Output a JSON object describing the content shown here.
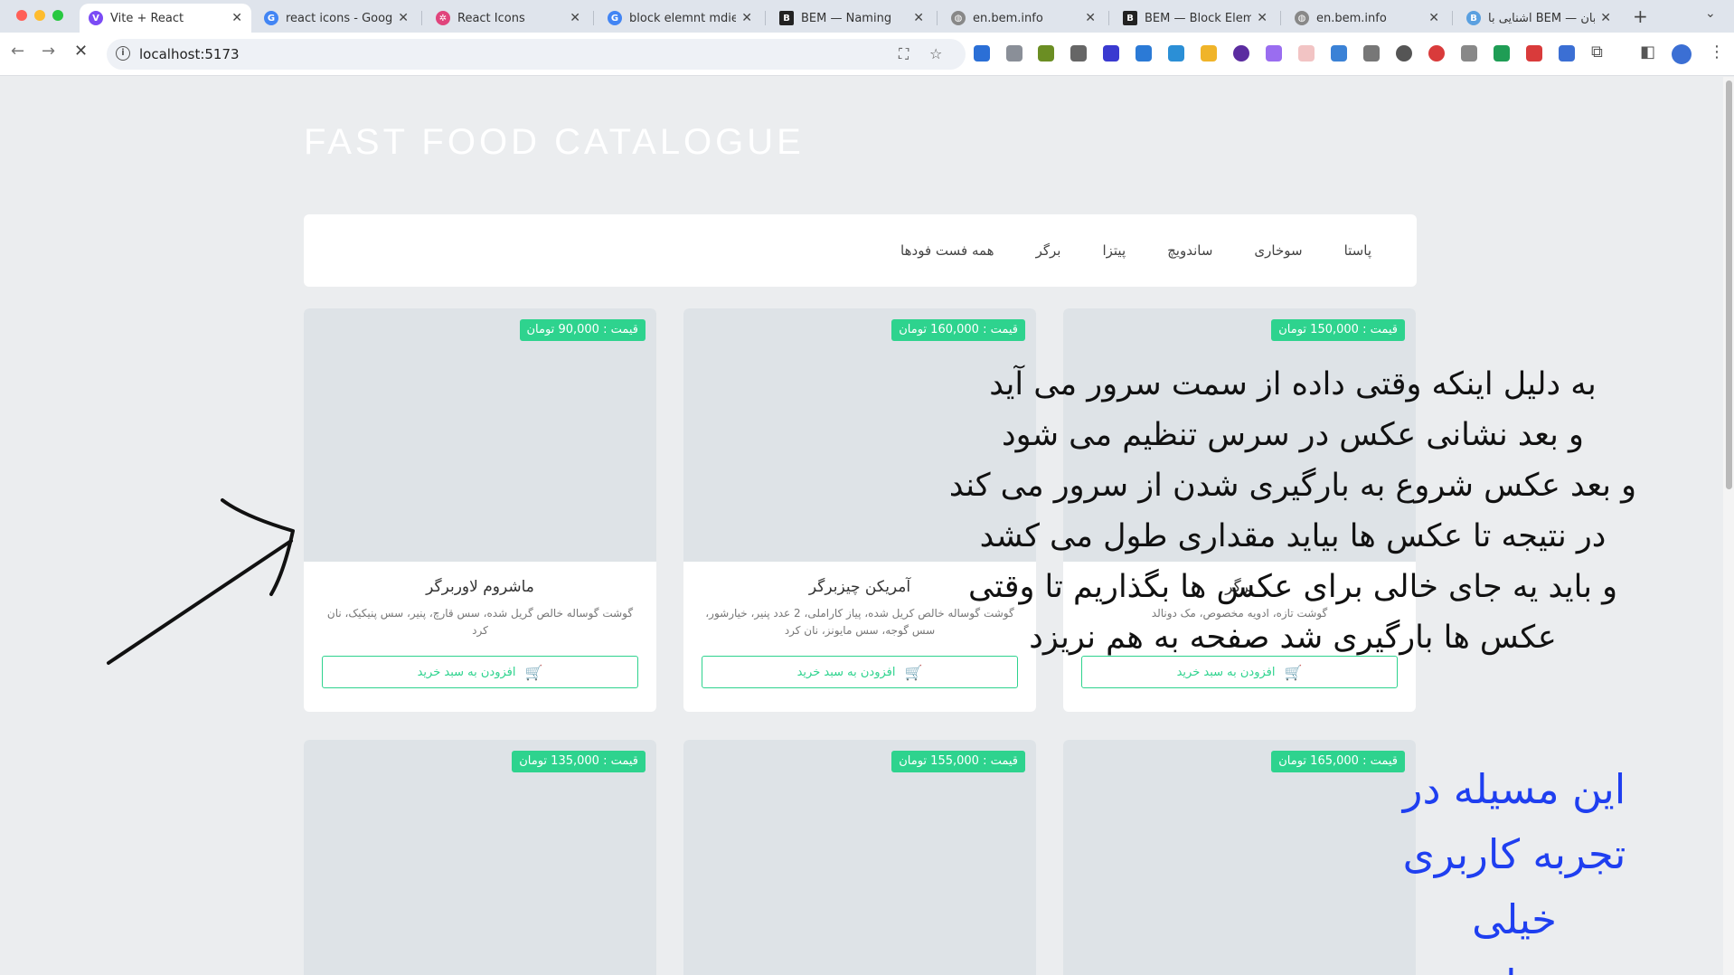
{
  "browser": {
    "tabs": [
      {
        "label": "Vite + React",
        "active": true,
        "favicon": "vite-icon",
        "favicon_color": "#7b4bf5"
      },
      {
        "label": "react icons - Google",
        "active": false,
        "favicon": "google-icon",
        "favicon_color": "#4285f4"
      },
      {
        "label": "React Icons",
        "active": false,
        "favicon": "react-icon",
        "favicon_color": "#e0447c"
      },
      {
        "label": "block elemnt mdier",
        "active": false,
        "favicon": "google-icon",
        "favicon_color": "#4285f4"
      },
      {
        "label": "BEM — Naming",
        "active": false,
        "favicon": "bem-icon",
        "favicon_color": "#222222"
      },
      {
        "label": "en.bem.info",
        "active": false,
        "favicon": "globe-icon",
        "favicon_color": "#666666"
      },
      {
        "label": "BEM — Block Elemen",
        "active": false,
        "favicon": "bem-icon",
        "favicon_color": "#222222"
      },
      {
        "label": "en.bem.info",
        "active": false,
        "favicon": "globe-icon",
        "favicon_color": "#666666"
      },
      {
        "label": "آشنایی با BEM — به زبان",
        "active": false,
        "favicon": "bem-icon",
        "favicon_color": "#5aa0e0"
      }
    ],
    "url": "localhost:5173"
  },
  "page": {
    "title": "FAST FOOD CATALOGUE",
    "menu": [
      "همه فست فودها",
      "برگر",
      "پیتزا",
      "ساندویچ",
      "سوخاری",
      "پاستا"
    ],
    "products": [
      {
        "price": "قیمت : 150,000 تومان",
        "name": "برگر",
        "desc": "گوشت تازه، ادویه مخصوص، مک دونالد",
        "button": "افزودن به سبد خرید"
      },
      {
        "price": "قیمت : 160,000 تومان",
        "name": "آمریکن چیزبرگر",
        "desc": "گوشت گوساله خالص کریل شده، پیاز کاراملی، 2 عدد پنیر، خیارشور، سس گوجه، سس مایونز، نان کرد",
        "button": "افزودن به سبد خرید"
      },
      {
        "price": "قیمت : 90,000 تومان",
        "name": "ماشروم لاوربرگر",
        "desc": "گوشت گوساله خالص گریل شده، سس قارچ، پنیر، سس پنیکیک، نان کرد",
        "button": "افزودن به سبد خرید"
      },
      {
        "price": "قیمت : 165,000 تومان"
      },
      {
        "price": "قیمت : 155,000 تومان"
      },
      {
        "price": "قیمت : 135,000 تومان"
      }
    ]
  },
  "annotations": {
    "black_lines": [
      "به دلیل اینکه وقتی داده از سمت سرور می آید",
      "و بعد نشانی عکس در سرس تنظیم می شود",
      "و بعد عکس شروع به بارگیری شدن از سرور می کند",
      "در نتیجه تا عکس ها بیاید مقداری طول می کشد",
      "و باید یه جای خالی برای عکس ها بگذاریم تا وقتی",
      "عکس ها بارگیری شد صفحه به هم نریزد"
    ],
    "blue_lines": [
      "این مسیله در",
      "تجربه کاربری",
      "خیلی",
      "مهم است"
    ],
    "black_color": "#111111",
    "blue_color": "#1f3ff0"
  },
  "colors": {
    "accent": "#2ed38e",
    "background": "#ebedef",
    "image_placeholder": "#dee3e7"
  }
}
